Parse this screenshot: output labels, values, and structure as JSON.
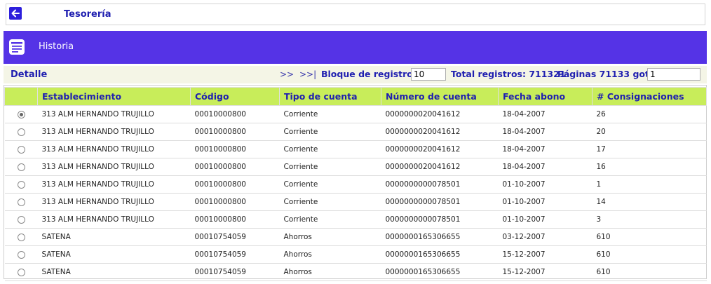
{
  "header": {
    "title": "Tesorería",
    "back_icon": "arrow-left-icon"
  },
  "section": {
    "title": "Historia",
    "icon": "list-document-icon",
    "color": "#5533e6"
  },
  "toolbar": {
    "detail_label": "Detalle",
    "next_label": ">>",
    "last_label": ">>|",
    "block_label": "Bloque de registros:",
    "block_value": "10",
    "total_label": "Total registros: 711321",
    "pages_label": "Páginas 71133 goto:",
    "goto_value": "1"
  },
  "table": {
    "columns": [
      "",
      "Establecimiento",
      "Código",
      "Tipo de cuenta",
      "Número de cuenta",
      "Fecha abono",
      "# Consignaciones"
    ],
    "rows": [
      {
        "selected": true,
        "cells": [
          "313 ALM HERNANDO TRUJILLO",
          "00010000800",
          "Corriente",
          "0000000020041612",
          "18-04-2007",
          "26"
        ]
      },
      {
        "selected": false,
        "cells": [
          "313 ALM HERNANDO TRUJILLO",
          "00010000800",
          "Corriente",
          "0000000020041612",
          "18-04-2007",
          "20"
        ]
      },
      {
        "selected": false,
        "cells": [
          "313 ALM HERNANDO TRUJILLO",
          "00010000800",
          "Corriente",
          "0000000020041612",
          "18-04-2007",
          "17"
        ]
      },
      {
        "selected": false,
        "cells": [
          "313 ALM HERNANDO TRUJILLO",
          "00010000800",
          "Corriente",
          "0000000020041612",
          "18-04-2007",
          "16"
        ]
      },
      {
        "selected": false,
        "cells": [
          "313 ALM HERNANDO TRUJILLO",
          "00010000800",
          "Corriente",
          "0000000000078501",
          "01-10-2007",
          "1"
        ]
      },
      {
        "selected": false,
        "cells": [
          "313 ALM HERNANDO TRUJILLO",
          "00010000800",
          "Corriente",
          "0000000000078501",
          "01-10-2007",
          "14"
        ]
      },
      {
        "selected": false,
        "cells": [
          "313 ALM HERNANDO TRUJILLO",
          "00010000800",
          "Corriente",
          "0000000000078501",
          "01-10-2007",
          "3"
        ]
      },
      {
        "selected": false,
        "cells": [
          "SATENA",
          "00010754059",
          "Ahorros",
          "0000000165306655",
          "03-12-2007",
          "610"
        ]
      },
      {
        "selected": false,
        "cells": [
          "SATENA",
          "00010754059",
          "Ahorros",
          "0000000165306655",
          "15-12-2007",
          "610"
        ]
      },
      {
        "selected": false,
        "cells": [
          "SATENA",
          "00010754059",
          "Ahorros",
          "0000000165306655",
          "15-12-2007",
          "610"
        ]
      }
    ]
  }
}
